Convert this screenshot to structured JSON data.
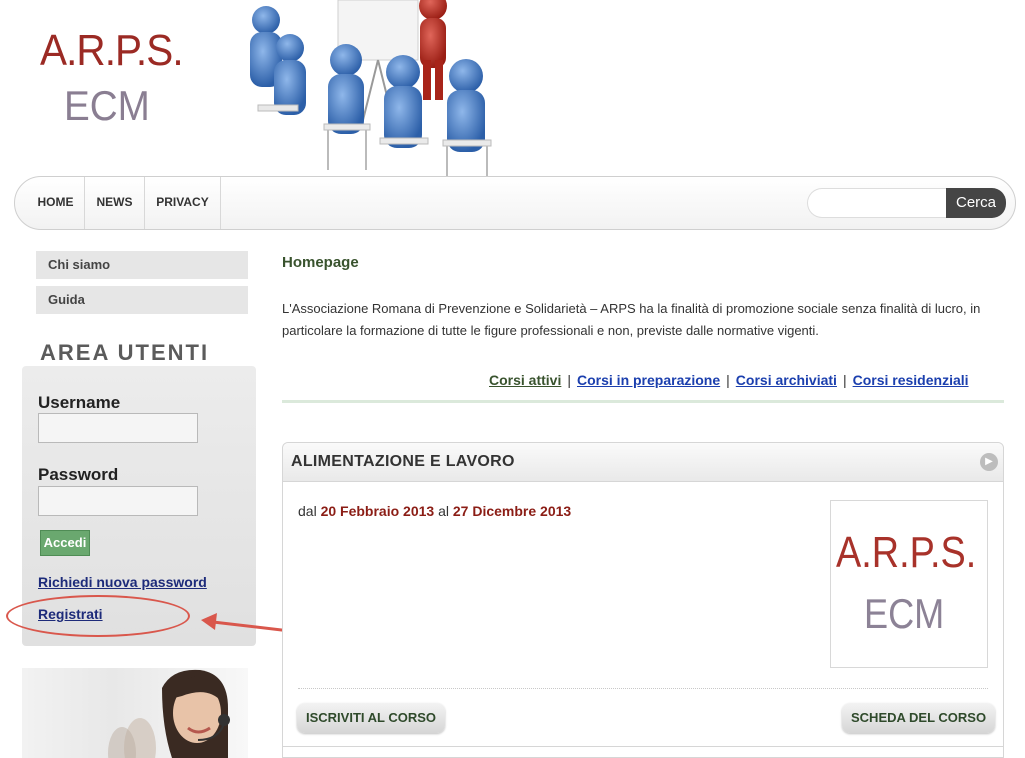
{
  "logo": {
    "line1": "A.R.P.S.",
    "line2": "ECM"
  },
  "nav": {
    "items": [
      {
        "label": "HOME"
      },
      {
        "label": "NEWS"
      },
      {
        "label": "PRIVACY"
      }
    ],
    "search": {
      "placeholder": "",
      "button_label": "Cerca"
    }
  },
  "sidebar": {
    "menu": [
      {
        "label": "Chi siamo"
      },
      {
        "label": "Guida"
      }
    ],
    "area_title": "AREA UTENTI",
    "login": {
      "username_label": "Username",
      "username_value": "",
      "password_label": "Password",
      "password_value": "",
      "submit_label": "Accedi",
      "forgot_link": "Richiedi nuova password",
      "register_link": "Registrati"
    }
  },
  "main": {
    "title": "Homepage",
    "intro": "L'Associazione Romana di Prevenzione e Solidarietà – ARPS ha la finalità di promozione sociale senza finalità di lucro, in particolare la formazione di tutte le figure professionali e non, previste dalle normative vigenti.",
    "course_links": [
      {
        "label": "Corsi attivi"
      },
      {
        "label": "Corsi in preparazione"
      },
      {
        "label": "Corsi archiviati"
      },
      {
        "label": "Corsi residenziali"
      }
    ],
    "course": {
      "title": "ALIMENTAZIONE E LAVORO",
      "date_prefix": "dal",
      "date_start": "20 Febbraio 2013",
      "date_mid": "al",
      "date_end": "27 Dicembre 2013",
      "thumb_line1": "A.R.P.S.",
      "thumb_line2": "ECM",
      "enroll_label": "ISCRIVITI AL CORSO",
      "details_label": "SCHEDA DEL CORSO"
    }
  },
  "colors": {
    "logo_red": "#9b2a24",
    "logo_purple": "#8a7e92",
    "title_green": "#39532e",
    "link_blue": "#1b3fae",
    "date_red": "#8b1d15",
    "annotation_red": "#d9574c"
  }
}
